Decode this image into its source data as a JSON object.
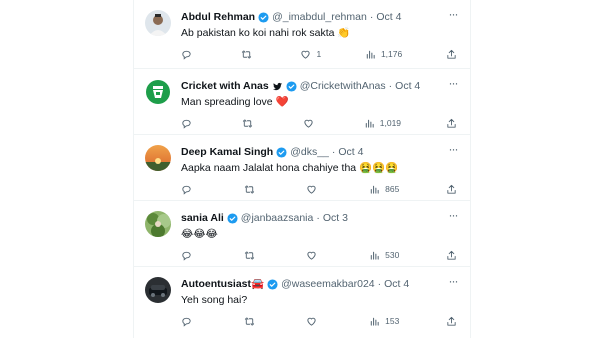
{
  "tweets": [
    {
      "name": "Abdul Rehman",
      "handle": "@_imabdul_rehman",
      "separator": "·",
      "date": "Oct 4",
      "text": "Ab pakistan ko koi nahi rok sakta 👏",
      "replies": "",
      "retweets": "",
      "likes": "1",
      "views": "1,176",
      "avatar": "man-portrait",
      "verified": true
    },
    {
      "name": "Cricket with Anas",
      "handle": "@CricketwithAnas",
      "separator": "·",
      "date": "Oct 4",
      "text": "Man spreading love ❤️",
      "replies": "",
      "retweets": "",
      "likes": "",
      "views": "1,019",
      "avatar": "cricket-logo",
      "verified": true
    },
    {
      "name": "Deep Kamal Singh",
      "handle": "@dks__",
      "separator": "·",
      "date": "Oct 4",
      "text": "Aapka naam Jalalat hona chahiye tha 🤮🤮🤮",
      "replies": "",
      "retweets": "",
      "likes": "",
      "views": "865",
      "avatar": "sunset",
      "verified": true
    },
    {
      "name": "sania Ali",
      "handle": "@janbaazsania",
      "separator": "·",
      "date": "Oct 3",
      "text": "😂😂😂",
      "replies": "",
      "retweets": "",
      "likes": "",
      "views": "530",
      "avatar": "greenery",
      "verified": true
    },
    {
      "name": "Autoentusiast🚘",
      "handle": "@waseemakbar024",
      "separator": "·",
      "date": "Oct 4",
      "text": "Yeh song hai?",
      "replies": "",
      "retweets": "",
      "likes": "",
      "views": "153",
      "avatar": "car",
      "verified": true
    }
  ],
  "colors": {
    "text": "#0f1419",
    "muted": "#536471",
    "verified": "#1d9bf0",
    "border": "#eff3f4"
  }
}
